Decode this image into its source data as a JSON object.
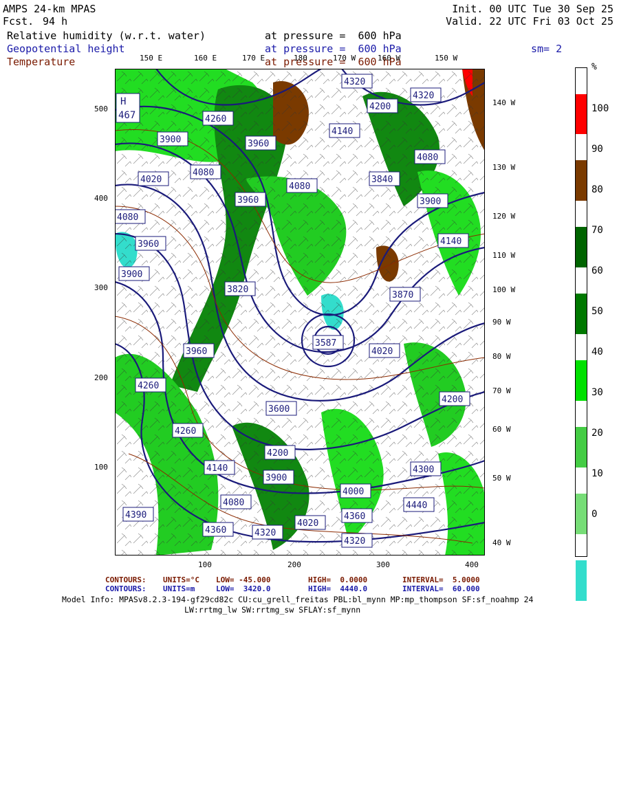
{
  "header": {
    "model": "AMPS 24-km MPAS",
    "fcst_label": "Fcst.",
    "fcst_value": "94 h",
    "init": "Init. 00 UTC Tue 30 Sep 25",
    "valid": "Valid. 22 UTC Fri 03 Oct 25",
    "fields": [
      {
        "name": "Relative humidity (w.r.t. water)",
        "pressure": "at pressure =  600 hPa",
        "color": "#000000"
      },
      {
        "name": "Geopotential height",
        "pressure": "at pressure =  600 hPa",
        "color": "#1a1aa8"
      },
      {
        "name": "Temperature",
        "pressure": "at pressure =  600 hPa",
        "color": "#7a1a00"
      }
    ],
    "smoothing": "sm= 2"
  },
  "axes": {
    "x_ticks": [
      "100",
      "200",
      "300",
      "400"
    ],
    "y_ticks": [
      "500",
      "400",
      "300",
      "200",
      "100"
    ],
    "top_lon": [
      "150 E",
      "160 E",
      "170 E",
      "180",
      "170 W",
      "160 W",
      "150 W"
    ],
    "right_lon": [
      "140 W",
      "130 W",
      "120 W",
      "110 W",
      "100 W",
      "90 W",
      "80 W",
      "70 W",
      "60 W",
      "50 W",
      "40 W"
    ]
  },
  "colorbar": {
    "unit": "%",
    "labels": [
      "100",
      "90",
      "80",
      "70",
      "60",
      "50",
      "40",
      "30",
      "20",
      "10",
      "0"
    ],
    "colors": [
      "#ff0000",
      "#7a3a00",
      "#006400",
      "#007800",
      "#00e000",
      "#44cc44",
      "#77dd77",
      "#33ddcc",
      "#ffffff",
      "#ffffff",
      "#ffffff",
      "#ffffff"
    ]
  },
  "map_labels": {
    "high": "H",
    "high_value": "467",
    "height_boxes": [
      "4320",
      "4320",
      "4200",
      "4260",
      "4140",
      "3900",
      "4080",
      "4020",
      "4080",
      "3840",
      "3960",
      "3900",
      "4080",
      "4140",
      "3960",
      "3900",
      "3870",
      "3820",
      "3587",
      "4020",
      "3960",
      "4260",
      "4200",
      "4260",
      "4140",
      "4200",
      "4300",
      "3900",
      "4000",
      "4360",
      "4440",
      "4020",
      "4080",
      "4360",
      "4320",
      "4390",
      "4320",
      "3960",
      "4080",
      "3600"
    ]
  },
  "footer": {
    "line1": {
      "c1": "CONTOURS:",
      "u1": "UNITS=°C",
      "l1": "LOW= -45.000",
      "h1": "HIGH=  0.0000",
      "i1": "INTERVAL=  5.0000"
    },
    "line2": {
      "c2": "CONTOURS:",
      "u2": "UNITS=m",
      "l2": "LOW=  3420.0",
      "h2": "HIGH=  4440.0",
      "i2": "INTERVAL=  60.000"
    },
    "model_info_1": "Model Info: MPASv8.2.3-194-gf29cd82c CU:cu_grell_freitas PBL:bl_mynn MP:mp_thompson SF:sf_noahmp 24",
    "model_info_2": "LW:rrtmg_lw SW:rrtmg_sw SFLAY:sf_mynn"
  }
}
